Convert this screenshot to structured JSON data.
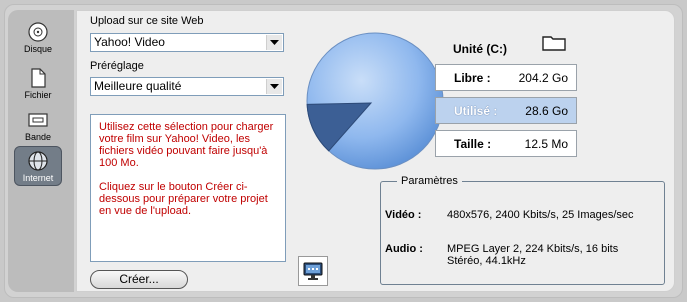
{
  "sidebar": {
    "items": [
      {
        "label": "Disque",
        "icon": "disc-icon"
      },
      {
        "label": "Fichier",
        "icon": "file-icon"
      },
      {
        "label": "Bande",
        "icon": "tape-icon"
      },
      {
        "label": "Internet",
        "icon": "globe-icon",
        "active": true
      }
    ]
  },
  "upload": {
    "site_label": "Upload sur ce site Web",
    "site_value": "Yahoo! Video",
    "preset_label": "Préréglage",
    "preset_value": "Meilleure qualité"
  },
  "info": {
    "paragraph1": "Utilisez cette sélection pour charger votre film sur Yahoo! Video, les fichiers vidéo pouvant faire jusqu'à 100 Mo.",
    "paragraph2": "Cliquez sur le bouton Créer ci-dessous pour préparer votre projet en vue de l'upload."
  },
  "create_button": "Créer...",
  "drive": {
    "title": "Unité (C:)",
    "free_label": "Libre :",
    "free_value": "204.2 Go",
    "used_label": "Utilisé :",
    "used_value": "28.6 Go",
    "size_label": "Taille :",
    "size_value": "12.5 Mo",
    "used_fraction": 0.123
  },
  "params": {
    "title": "Paramètres",
    "video_label": "Vidéo :",
    "video_value": "480x576, 2400 Kbits/s, 25 Images/sec",
    "audio_label": "Audio :",
    "audio_value_line1": "MPEG Layer 2, 224 Kbits/s, 16 bits",
    "audio_value_line2": "Stéréo, 44.1kHz"
  },
  "colors": {
    "pie_free": "#8fb8ee",
    "pie_used": "#3c5f95",
    "info_text": "#c00000",
    "highlight": "#bcd2ee"
  }
}
